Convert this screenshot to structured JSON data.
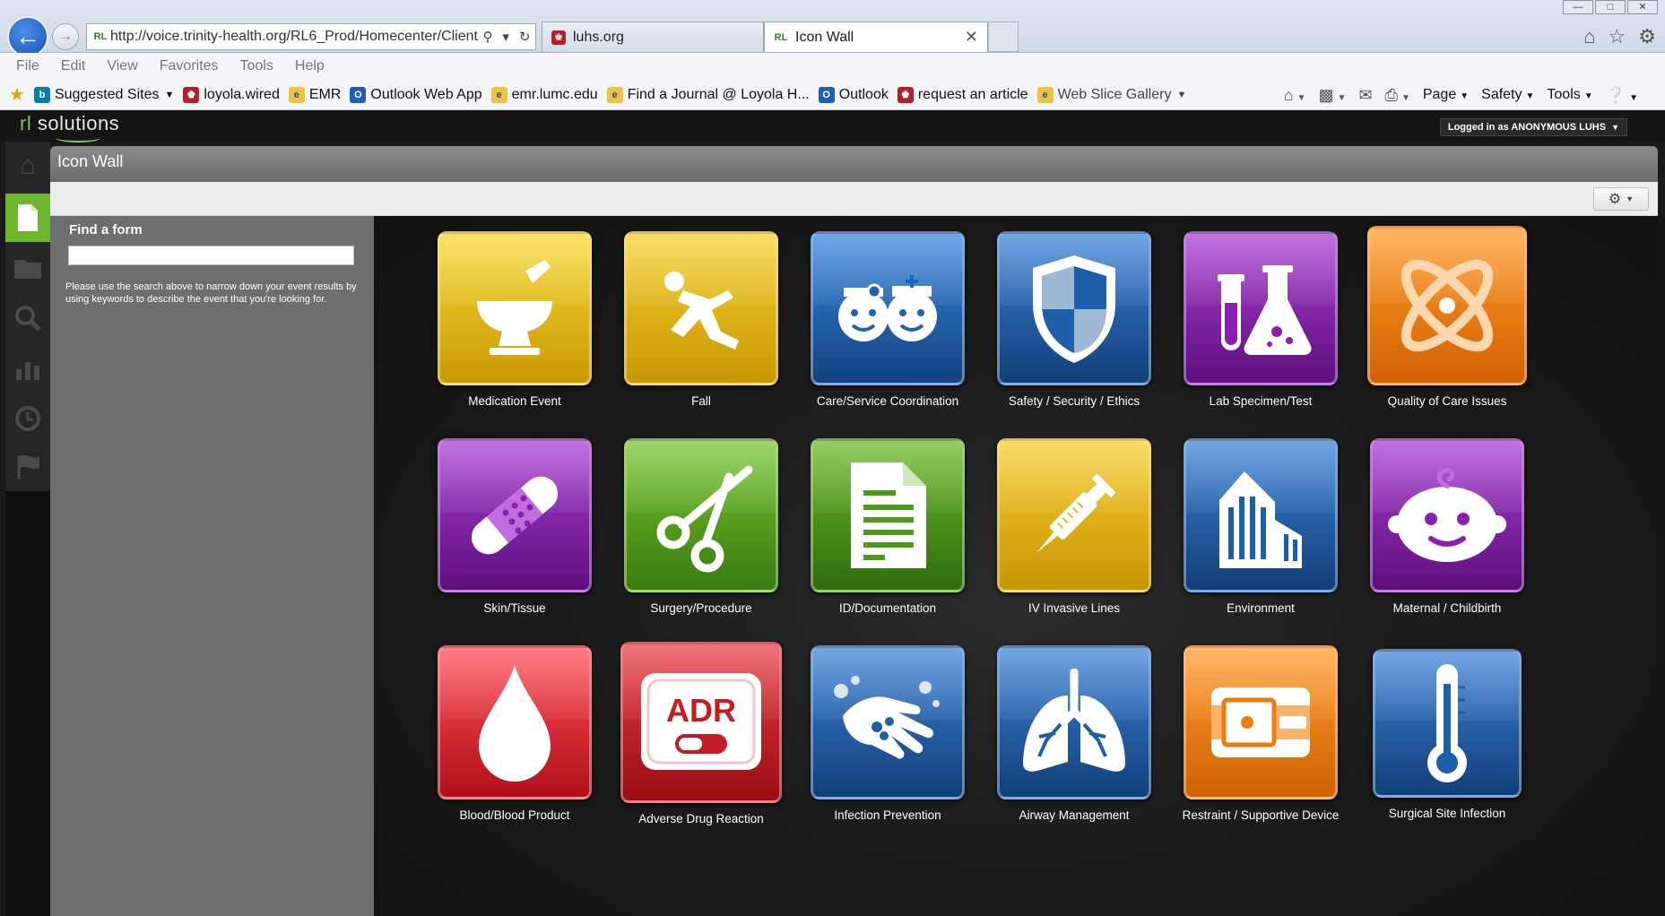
{
  "browser": {
    "address_url": "http://voice.trinity-health.org/RL6_Prod/Homecenter/Client/",
    "tabs": [
      {
        "label": "luhs.org",
        "active": false
      },
      {
        "label": "Icon Wall",
        "active": true
      }
    ],
    "menu": [
      "File",
      "Edit",
      "View",
      "Favorites",
      "Tools",
      "Help"
    ],
    "favorites": [
      {
        "label": "Suggested Sites",
        "dropdown": true,
        "icon": "bing-icon"
      },
      {
        "label": "loyola.wired",
        "icon": "loyola-icon"
      },
      {
        "label": "EMR",
        "icon": "ie-page-icon"
      },
      {
        "label": "Outlook Web App",
        "icon": "outlook-icon"
      },
      {
        "label": "emr.lumc.edu",
        "icon": "ie-page-icon"
      },
      {
        "label": "Find a Journal @ Loyola H...",
        "icon": "ie-page-icon"
      },
      {
        "label": "Outlook",
        "icon": "outlook-icon"
      },
      {
        "label": "request an article",
        "icon": "loyola-icon"
      },
      {
        "label": "Web Slice Gallery",
        "dropdown": true,
        "icon": "ie-page-icon"
      }
    ],
    "command_bar": {
      "page": "Page",
      "safety": "Safety",
      "tools": "Tools"
    }
  },
  "app": {
    "logo": {
      "prefix": "rl",
      "name": "solutions"
    },
    "login_badge": "Logged in as ANONYMOUS LUHS",
    "page_title": "Icon Wall",
    "find_form": {
      "label": "Find a form",
      "value": "",
      "help": "Please use the search above to narrow down your event results by using keywords to describe the event that you're looking for."
    },
    "tiles": [
      {
        "label": "Medication Event",
        "color": "#e9c21a",
        "icon": "mortar-pestle-icon"
      },
      {
        "label": "Fall",
        "color": "#e9b81a",
        "icon": "falling-person-icon"
      },
      {
        "label": "Care/Service Coordination",
        "color": "#1e63b4",
        "icon": "doctor-nurse-icon"
      },
      {
        "label": "Safety / Security / Ethics",
        "color": "#1d5fa8",
        "icon": "shield-icon"
      },
      {
        "label": "Lab Specimen/Test",
        "color": "#8a1fb0",
        "icon": "test-tube-flask-icon"
      },
      {
        "label": "Quality of Care Issues",
        "color": "#f07d0a",
        "icon": "atom-icon"
      },
      {
        "label": "Skin/Tissue",
        "color": "#8a1fb0",
        "icon": "bandage-icon"
      },
      {
        "label": "Surgery/Procedure",
        "color": "#5aa31d",
        "icon": "scissors-icon"
      },
      {
        "label": "ID/Documentation",
        "color": "#4f9a1d",
        "icon": "document-icon"
      },
      {
        "label": "IV Invasive Lines",
        "color": "#e6b81a",
        "icon": "syringe-icon"
      },
      {
        "label": "Environment",
        "color": "#1d5fa8",
        "icon": "building-icon"
      },
      {
        "label": "Maternal / Childbirth",
        "color": "#8a1fb0",
        "icon": "baby-face-icon"
      },
      {
        "label": "Blood/Blood Product",
        "color": "#d9202a",
        "icon": "blood-drop-icon"
      },
      {
        "label": "Adverse Drug Reaction",
        "color": "#c41b24",
        "icon": "adr-pill-icon",
        "icon_text": "ADR"
      },
      {
        "label": "Infection Prevention",
        "color": "#1d5fa8",
        "icon": "washing-hands-icon"
      },
      {
        "label": "Airway Management",
        "color": "#1d5fa8",
        "icon": "lungs-icon"
      },
      {
        "label": "Restraint / Supportive Device",
        "color": "#ec7d0c",
        "icon": "restraint-belt-icon"
      },
      {
        "label": "Surgical Site Infection",
        "color": "#1d5fa8",
        "icon": "thermometer-icon"
      }
    ]
  }
}
